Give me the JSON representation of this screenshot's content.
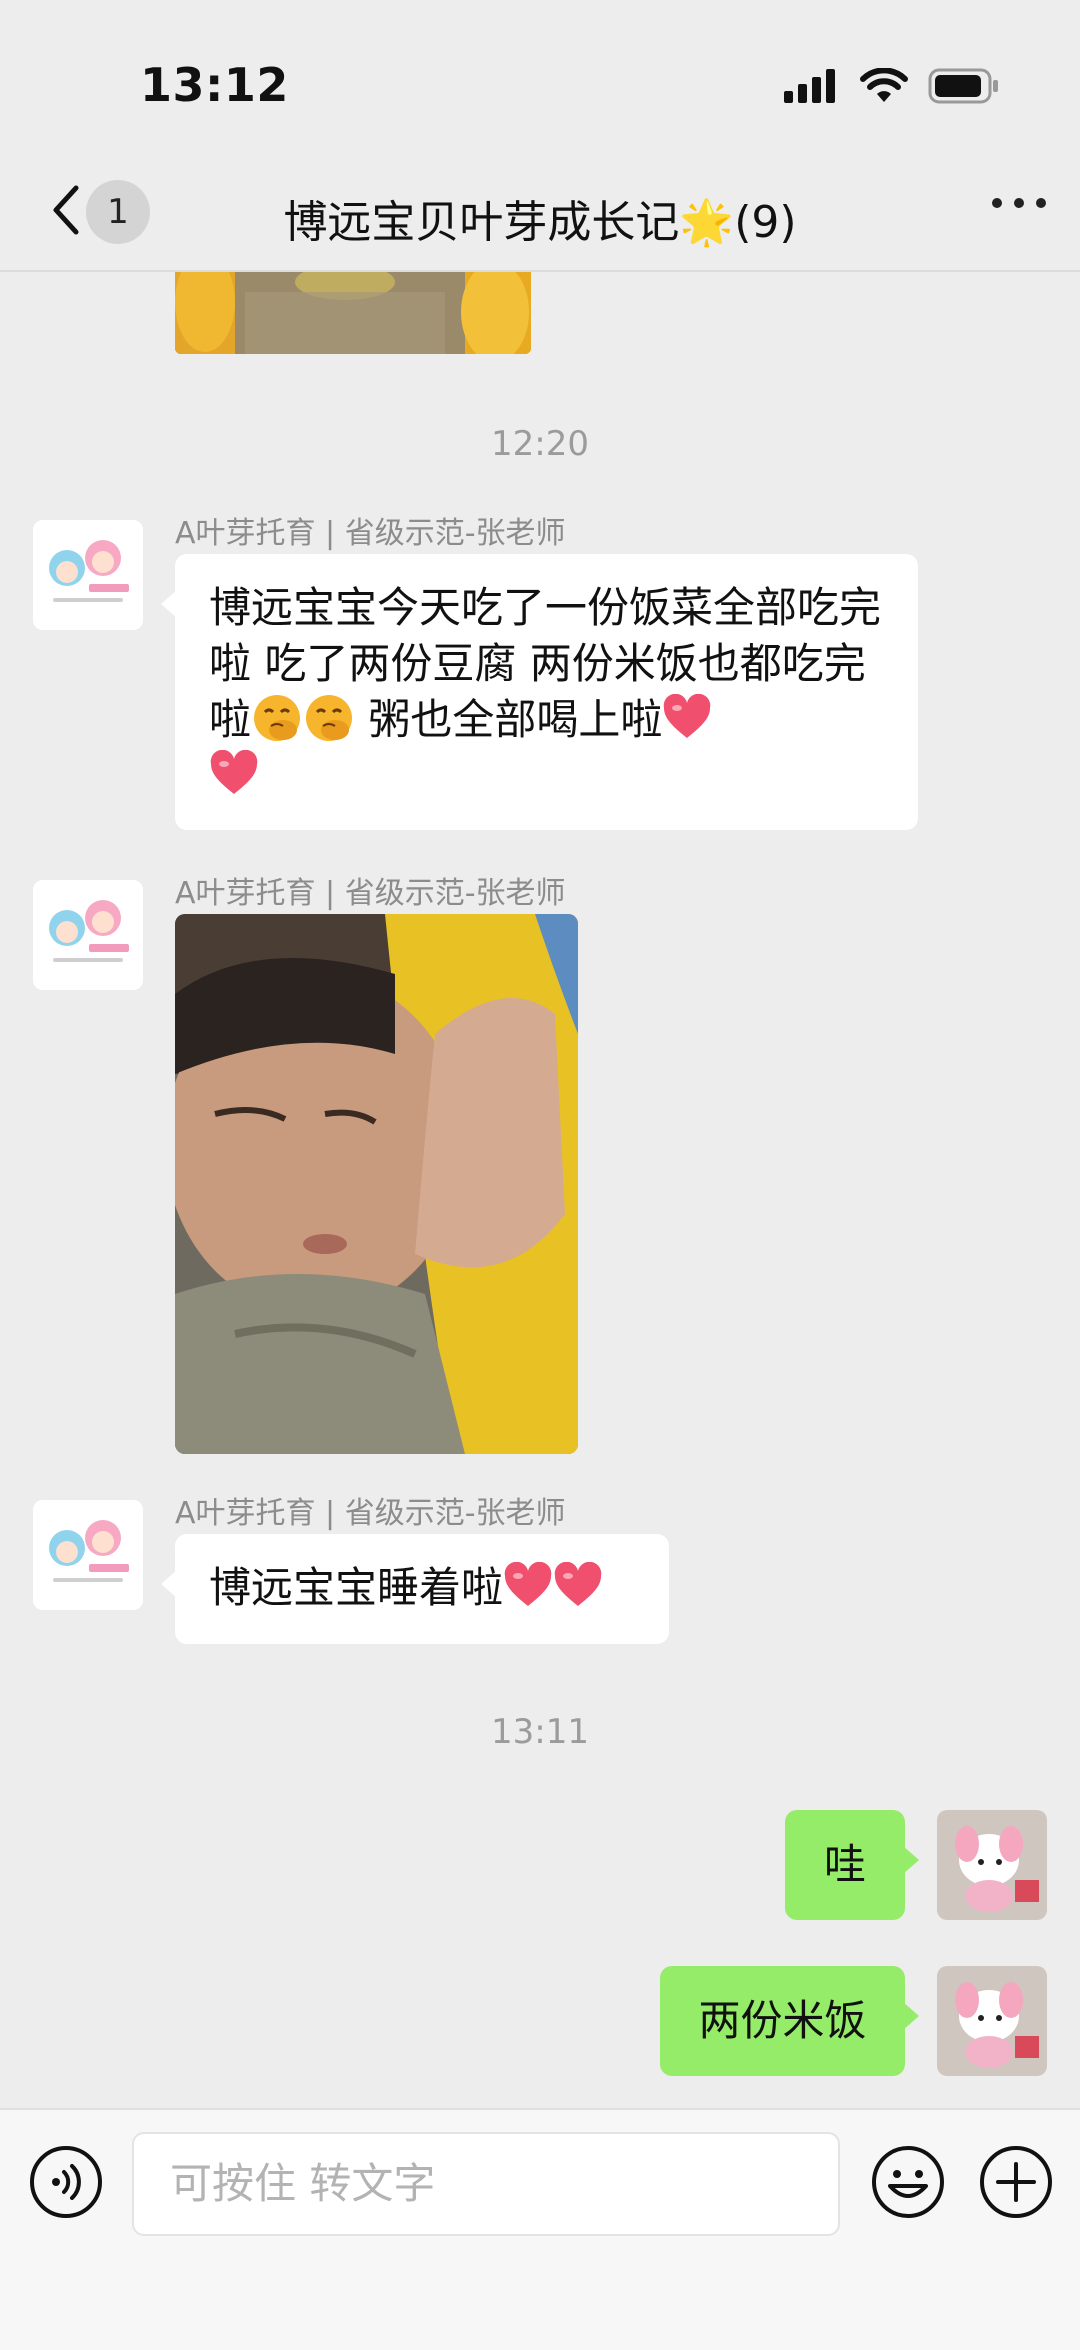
{
  "status_bar": {
    "time": "13:12"
  },
  "nav": {
    "unread_count": "1",
    "title": "博远宝贝叶芽成长记🌟(9)"
  },
  "messages": {
    "timestamp_1": "12:20",
    "timestamp_2": "13:11",
    "sender_name": "A叶芽托育 | 省级示范-张老师",
    "msg1_part1": "博远宝宝今天吃了一份饭菜全部吃完啦 吃了两份豆腐 两份米饭也都吃完啦",
    "msg1_part2": " 粥也全部喝上啦",
    "msg3_text": "博远宝宝睡着啦",
    "sent1": "哇",
    "sent2": "两份米饭"
  },
  "input": {
    "placeholder": "可按住 转文字"
  },
  "colors": {
    "background": "#ededed",
    "sent_bubble": "#95ec69",
    "received_bubble": "#ffffff",
    "heart": "#f0506e"
  },
  "icons": {
    "back": "chevron-left-icon",
    "more": "more-dots-icon",
    "voice": "voice-icon",
    "emoji": "emoji-icon",
    "plus": "plus-icon",
    "heart": "heart-icon",
    "smile": "smiling-face-with-hand-icon"
  }
}
